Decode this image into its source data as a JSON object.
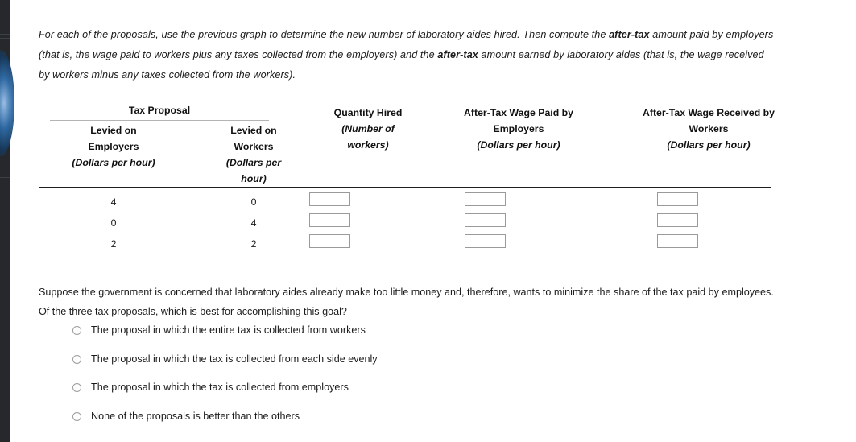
{
  "intro": {
    "part1": "For each of the proposals, use the previous graph to determine the new number of laboratory aides hired. Then compute the ",
    "bold1": "after-tax",
    "part2": " amount paid by employers (that is, the wage paid to workers plus any taxes collected from the employers) and the ",
    "bold2": "after-tax",
    "part3": " amount earned by laboratory aides (that is, the wage received by workers minus any taxes collected from the workers)."
  },
  "table": {
    "group_header": "Tax Proposal",
    "columns": [
      {
        "title": "Levied on Employers",
        "title_line1": "Levied on",
        "title_line2": "Employers",
        "units": "(Dollars per hour)"
      },
      {
        "title": "Levied on Workers",
        "title_line1": "Levied on",
        "title_line2": "Workers",
        "units_line1": "(Dollars per",
        "units_line2": "hour)"
      },
      {
        "title": "Quantity Hired",
        "units_line1": "(Number of",
        "units_line2": "workers)"
      },
      {
        "title_line1": "After-Tax Wage Paid by",
        "title_line2": "Employers",
        "units": "(Dollars per hour)"
      },
      {
        "title_line1": "After-Tax Wage Received by",
        "title_line2": "Workers",
        "units": "(Dollars per hour)"
      }
    ],
    "rows": [
      {
        "levied_employers": "4",
        "levied_workers": "0",
        "quantity_hired": "",
        "after_tax_paid": "",
        "after_tax_received": ""
      },
      {
        "levied_employers": "0",
        "levied_workers": "4",
        "quantity_hired": "",
        "after_tax_paid": "",
        "after_tax_received": ""
      },
      {
        "levied_employers": "2",
        "levied_workers": "2",
        "quantity_hired": "",
        "after_tax_paid": "",
        "after_tax_received": ""
      }
    ]
  },
  "question": {
    "text": "Suppose the government is concerned that laboratory aides already make too little money and, therefore, wants to minimize the share of the tax paid by employees. Of the three tax proposals, which is best for accomplishing this goal?"
  },
  "options": [
    {
      "label": "The proposal in which the entire tax is collected from workers",
      "selected": false
    },
    {
      "label": "The proposal in which the tax is collected from each side evenly",
      "selected": false
    },
    {
      "label": "The proposal in which the tax is collected from employers",
      "selected": false
    },
    {
      "label": "None of the proposals is better than the others",
      "selected": false
    }
  ],
  "colors": {
    "rail_background": "#26282b",
    "rail_accent": "#2f6ca8",
    "page_background": "#ffffff",
    "text": "#1b1b1b",
    "rule": "#1e1e1e",
    "input_border": "#9a9a9a"
  }
}
